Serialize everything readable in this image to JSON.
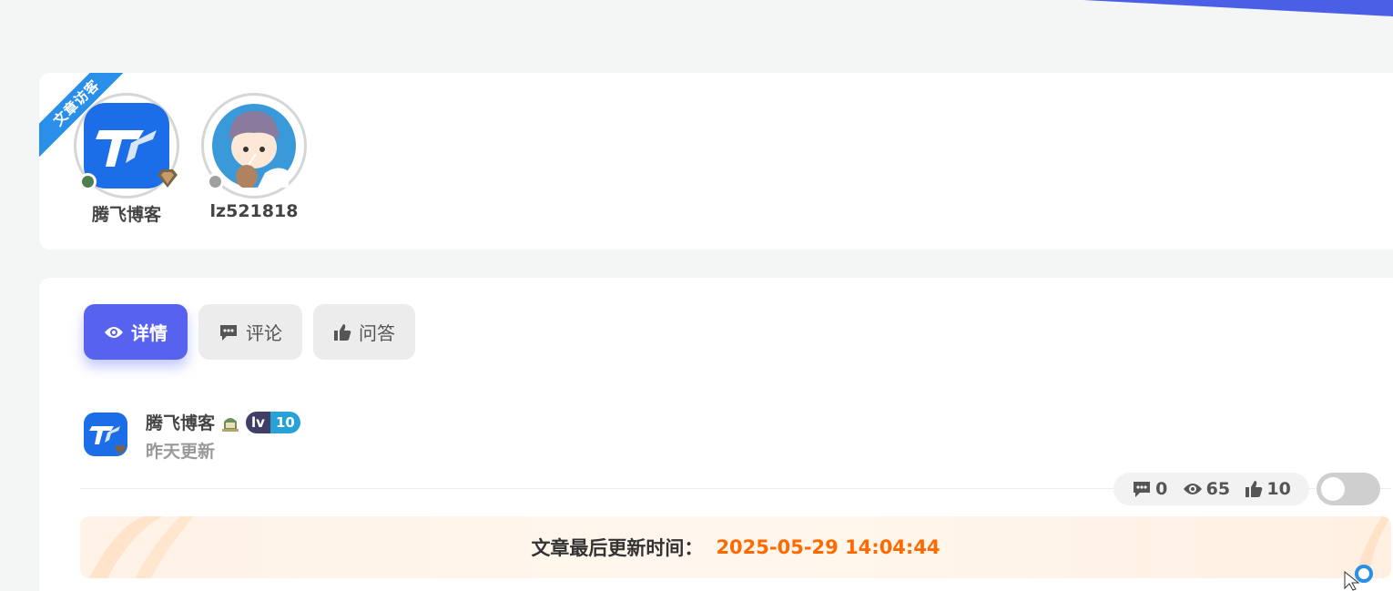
{
  "visitors": {
    "ribbon_label": "文章访客",
    "items": [
      {
        "name": "腾飞博客",
        "status": "online",
        "status_color": "#4f7f4f"
      },
      {
        "name": "lz521818",
        "status": "offline",
        "status_color": "#a0a0a0"
      }
    ]
  },
  "tabs": [
    {
      "label": "详情",
      "icon": "eye-icon",
      "active": true
    },
    {
      "label": "评论",
      "icon": "comment-icon",
      "active": false
    },
    {
      "label": "问答",
      "icon": "thumbs-up-icon",
      "active": false
    }
  ],
  "author": {
    "name": "腾飞博客",
    "updated": "昨天更新",
    "level_prefix": "lv",
    "level": "10"
  },
  "stats": {
    "comments": "0",
    "views": "65",
    "likes": "10"
  },
  "update_bar": {
    "label": "文章最后更新时间：",
    "value": "2025-05-29 14:04:44"
  },
  "colors": {
    "accent": "#5763ef",
    "ribbon": "#2a8fe8",
    "update_value": "#ff6a00"
  }
}
